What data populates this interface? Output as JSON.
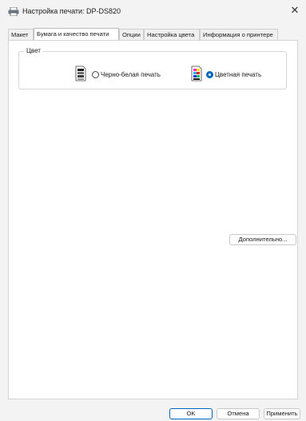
{
  "window": {
    "title": "Настройка печати: DP-DS820",
    "title_icon": "printer-icon",
    "close_glyph": "✕"
  },
  "tabs": [
    {
      "label": "Макет",
      "active": false
    },
    {
      "label": "Бумага и качество печати",
      "active": true
    },
    {
      "label": "Опции",
      "active": false
    },
    {
      "label": "Настройка цвета",
      "active": false
    },
    {
      "label": "Информация о принтере",
      "active": false
    }
  ],
  "color_group": {
    "label": "Цвет",
    "options": [
      {
        "label": "Черно-белая печать",
        "icon": "monochrome-print-icon",
        "selected": false
      },
      {
        "label": "Цветная печать",
        "icon": "color-print-icon",
        "selected": true
      }
    ]
  },
  "panel": {
    "advanced_label": "Дополнительно..."
  },
  "footer": {
    "ok_label": "OK",
    "cancel_label": "Отмена",
    "apply_label": "Применить"
  },
  "colors": {
    "accent": "#0067c0",
    "window_bg": "#f3f3f3",
    "panel_bg": "#ffffff"
  }
}
